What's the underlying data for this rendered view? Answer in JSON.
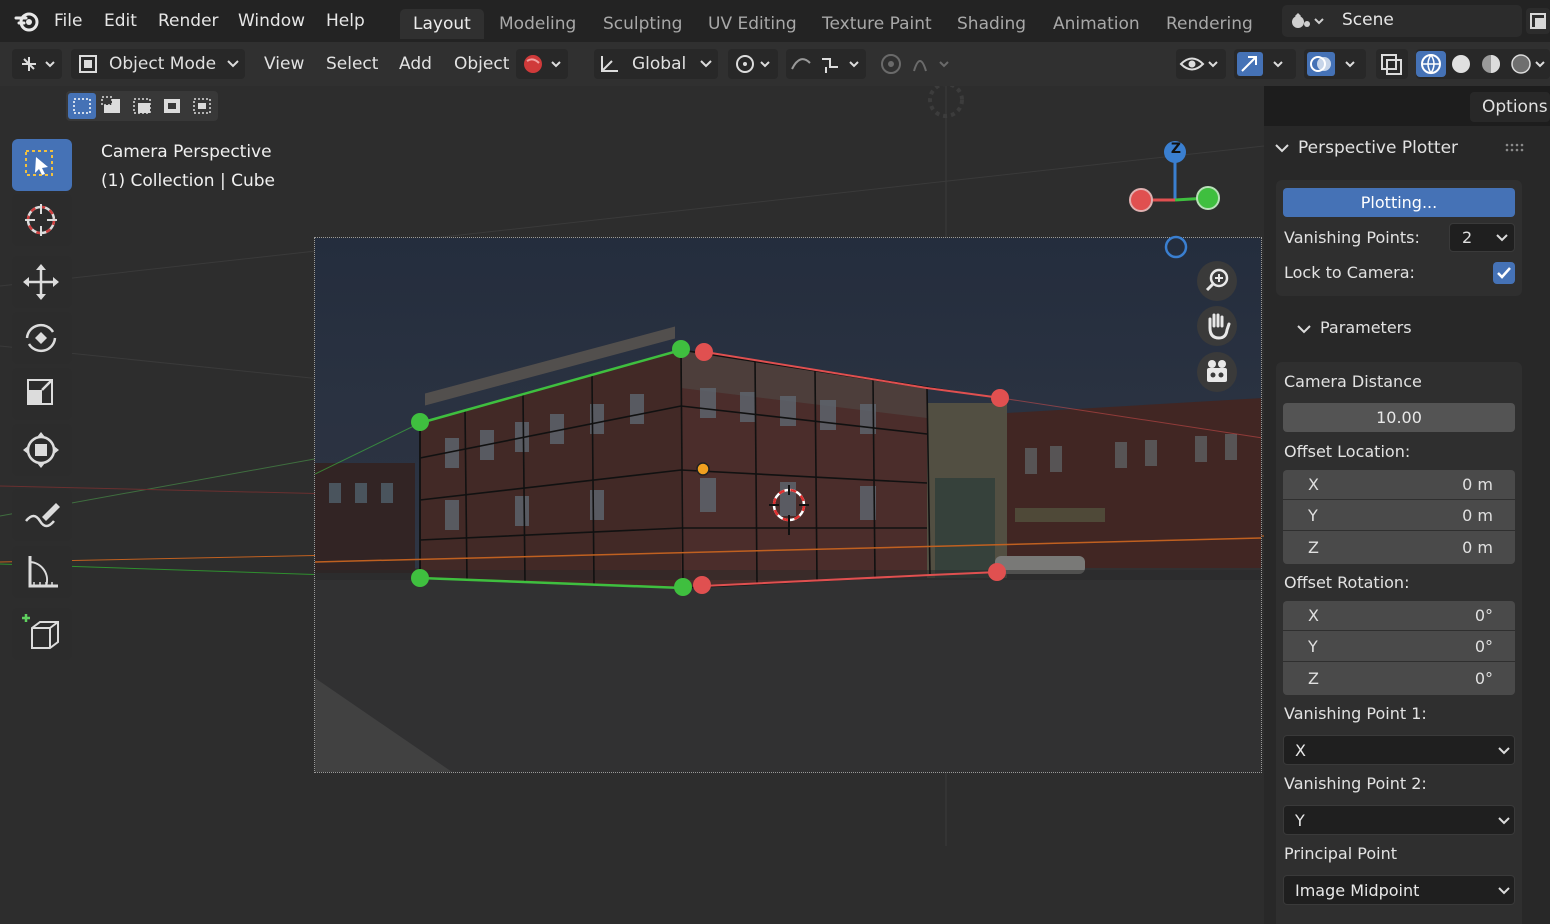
{
  "menu": {
    "file": "File",
    "edit": "Edit",
    "render": "Render",
    "window": "Window",
    "help": "Help"
  },
  "workspaces": [
    "Layout",
    "Modeling",
    "Sculpting",
    "UV Editing",
    "Texture Paint",
    "Shading",
    "Animation",
    "Rendering"
  ],
  "scene": {
    "name": "Scene"
  },
  "header": {
    "mode": "Object Mode",
    "view": "View",
    "select": "Select",
    "add": "Add",
    "object": "Object",
    "orientation": "Global",
    "options": "Options"
  },
  "viewport": {
    "title": "Camera Perspective",
    "subtitle": "(1) Collection | Cube",
    "gizmo_z": "Z"
  },
  "panel": {
    "title": "Perspective Plotter",
    "plot_button": "Plotting...",
    "vp_label": "Vanishing Points:",
    "vp_value": "2",
    "lock_label": "Lock to Camera:",
    "lock_checked": true,
    "params_title": "Parameters",
    "camera_distance_label": "Camera Distance",
    "camera_distance": "10.00",
    "offset_location_label": "Offset Location:",
    "offset_location": [
      {
        "axis": "X",
        "value": "0 m"
      },
      {
        "axis": "Y",
        "value": "0 m"
      },
      {
        "axis": "Z",
        "value": "0 m"
      }
    ],
    "offset_rotation_label": "Offset Rotation:",
    "offset_rotation": [
      {
        "axis": "X",
        "value": "0°"
      },
      {
        "axis": "Y",
        "value": "0°"
      },
      {
        "axis": "Z",
        "value": "0°"
      }
    ],
    "vp1_label": "Vanishing Point 1:",
    "vp1_value": "X",
    "vp2_label": "Vanishing Point 2:",
    "vp2_value": "Y",
    "principal_label": "Principal Point",
    "principal_value": "Image Midpoint"
  },
  "colors": {
    "accent": "#4572b6",
    "axis_x": "#e05050",
    "axis_y": "#3fbf3f",
    "axis_z": "#3a7fd0",
    "horizon": "#d07030"
  }
}
